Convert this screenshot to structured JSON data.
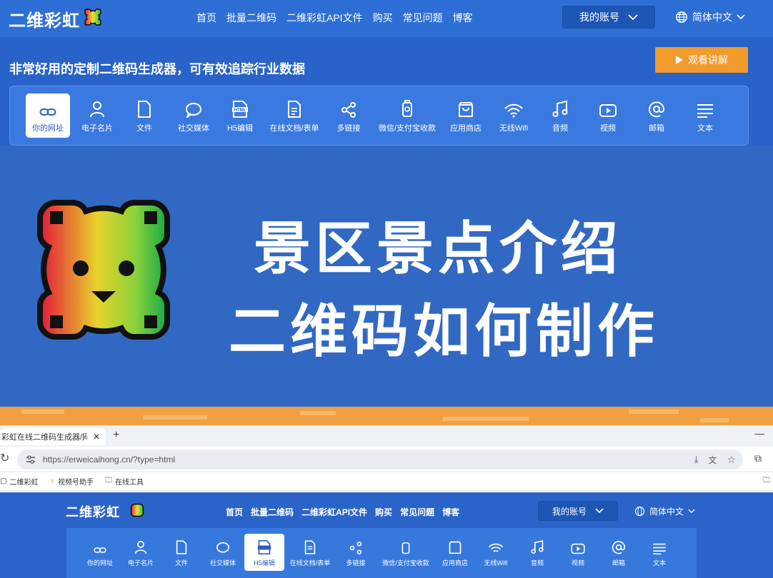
{
  "nav": {
    "logo": "二维彩虹",
    "links": [
      "首页",
      "批量二维码",
      "二维彩虹API文件",
      "购买",
      "常见问题",
      "博客"
    ],
    "account": "我的账号",
    "language": "简体中文"
  },
  "hero": {
    "headline": "非常好用的定制二维码生成器，可有效追踪行业数据",
    "watch_button": "观看讲解"
  },
  "tools": [
    {
      "label": "你的网址",
      "icon": "link-icon"
    },
    {
      "label": "电子名片",
      "icon": "person-icon"
    },
    {
      "label": "文件",
      "icon": "file-icon"
    },
    {
      "label": "社交媒体",
      "icon": "chat-bubble-icon"
    },
    {
      "label": "H5编辑",
      "icon": "html-icon"
    },
    {
      "label": "在线文档/表单",
      "icon": "document-icon"
    },
    {
      "label": "多链接",
      "icon": "share-icon"
    },
    {
      "label": "微信/支付宝收款",
      "icon": "payment-icon"
    },
    {
      "label": "应用商店",
      "icon": "shopping-bag-icon"
    },
    {
      "label": "无线Wifi",
      "icon": "wifi-icon"
    },
    {
      "label": "音频",
      "icon": "music-icon"
    },
    {
      "label": "视频",
      "icon": "video-icon"
    },
    {
      "label": "邮箱",
      "icon": "at-icon"
    },
    {
      "label": "文本",
      "icon": "text-lines-icon"
    }
  ],
  "active_tool": "你的网址",
  "cover": {
    "line1": "景区景点介绍",
    "line2": "二维码如何制作"
  },
  "browser": {
    "tab_title": "彩虹在线二维码生成器/网",
    "url": "https://erweicaihong.cn/?type=html",
    "bookmarks": [
      "二维彩虹",
      "视频号助手",
      "在线工具"
    ]
  },
  "mini_site": {
    "logo": "二维彩虹",
    "links": [
      "首页",
      "批量二维码",
      "二维彩虹API文件",
      "购买",
      "常见问题",
      "博客"
    ],
    "account": "我的账号",
    "language": "简体中文",
    "active_tool": "H5编辑"
  },
  "colors": {
    "nav_bg": "#2e6fd6",
    "hero_bg": "#2763c8",
    "cover_bg": "#3168c3",
    "accent_orange": "#f19b2c"
  }
}
